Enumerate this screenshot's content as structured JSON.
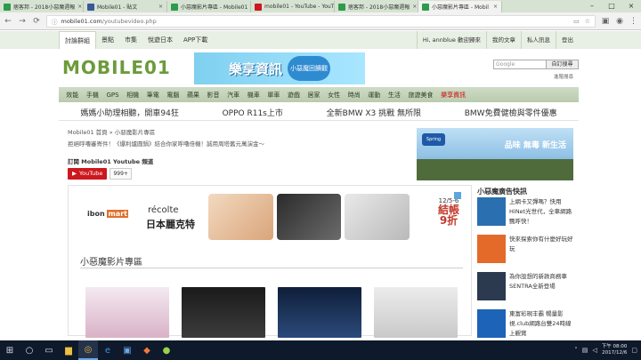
{
  "browser": {
    "tabs": [
      {
        "title": "痞客邦 - 2018小惡魔週報",
        "active": false,
        "color": "#2e9b4a"
      },
      {
        "title": "Mobile01 - 貼文",
        "active": false,
        "color": "#3b5998"
      },
      {
        "title": "小惡魔影片專區 - Mobile01",
        "active": false,
        "color": "#2e9b4a"
      },
      {
        "title": "mobile01 - YouTube - YouTu",
        "active": false,
        "color": "#cc181e"
      },
      {
        "title": "痞客邦 - 2018小惡魔週報",
        "active": false,
        "color": "#2e9b4a"
      },
      {
        "title": "小惡魔影片專區 - Mobil",
        "active": true,
        "color": "#2e9b4a"
      }
    ],
    "window_controls": [
      "–",
      "□",
      "×"
    ],
    "address": {
      "host": "mobile01.com",
      "path": "/youtubevideo.php"
    }
  },
  "site_bar": {
    "tabs": [
      "討論群組",
      "景點",
      "市集",
      "悅遊日本",
      "APP下載"
    ],
    "user": [
      "Hi, annblue 歡迎歸來",
      "我的文章",
      "私人訊息",
      "登出"
    ]
  },
  "header": {
    "logo": "MOBILE01",
    "banner_title": "樂享資訊",
    "banner_badge": "小惡魔回饋觀",
    "search_placeholder": "Google",
    "search_button": "自訂搜尋",
    "advanced_search": "進階搜尋"
  },
  "category_nav": [
    "效能",
    "手機",
    "GPS",
    "相機",
    "筆電",
    "電腦",
    "蘋果",
    "影音",
    "汽車",
    "機車",
    "單車",
    "遊戲",
    "居家",
    "女性",
    "時尚",
    "運動",
    "生活",
    "旅遊美食",
    "樂享資訊"
  ],
  "promos": [
    "媽媽小助理相聽，開車94狂",
    "OPPO R11s上市",
    "全新BMW X3 挑戰 無所限",
    "BMW免費健檢與零件優惠"
  ],
  "main": {
    "breadcrumb": "Mobile01 首頁 » 小惡魔影片專區",
    "subtitle": "拒絕呼嚕審寄件！《爆利爐圓鍋》結合你家呼嚕倍機！誠用周塔舊元萬演金～",
    "subscribe_label": "訂閱 Mobile01 Youtube 頻道",
    "youtube_button": "YouTube",
    "subscriber_count": "999+",
    "section_title": "小惡魔影片專區"
  },
  "ads": {
    "right_top_text": "品味 無毒 新生活",
    "right_top_logo": "Spring",
    "ibon_line1": "ibon",
    "ibon_line2": "mart",
    "recolte": "récolte",
    "recolte_jp": "日本麗克特",
    "offer_date": "12/5-6",
    "offer_big": "結帳",
    "offer_discount": "9折"
  },
  "sidebar": {
    "title": "小惡魔廣告快訊",
    "items": [
      {
        "text": "上網卡又彈嗎？快用HiNet光世代，全車網路飄呼快！",
        "color": "#2a6fb0"
      },
      {
        "text": "快來探索你有什麼好玩好玩",
        "color": "#e46a2a"
      },
      {
        "text": "為你設想的新款商務車 SENTRA全新登場",
        "color": "#2b3a4f"
      },
      {
        "text": "東富彩現丰霸 暢量影視.club網路台雙24時線上觀賞",
        "color": "#1d63b8"
      }
    ]
  },
  "taskbar": {
    "clock_time": "下午 08:00",
    "clock_date": "2017/12/6"
  }
}
